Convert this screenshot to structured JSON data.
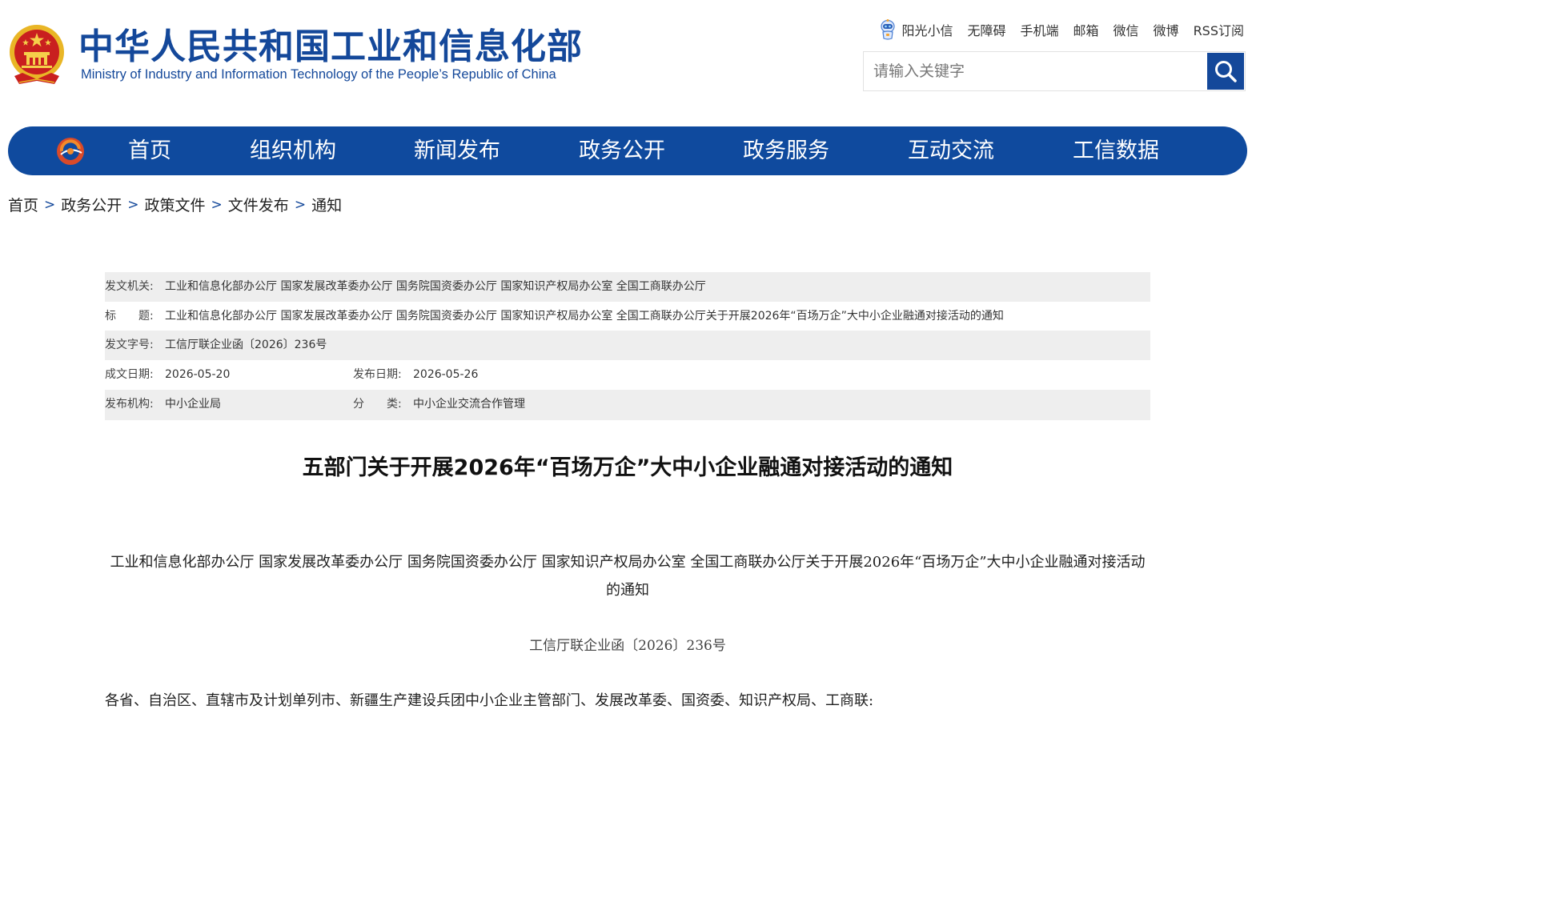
{
  "header": {
    "title_cn": "中华人民共和国工业和信息化部",
    "title_en": "Ministry of Industry and Information Technology of the People’s Republic of China",
    "emblem_icon": "national-emblem-icon",
    "brand_color": "#14489a"
  },
  "toplinks": {
    "sunshine_label": "阳光小信",
    "sunshine_icon": "robot-mascot-icon",
    "accessibility": "无障碍",
    "mobile": "手机端",
    "mailbox": "邮箱",
    "wechat": "微信",
    "weibo": "微博",
    "rss": "RSS订阅"
  },
  "search": {
    "placeholder": "请输入关键字",
    "button_icon": "search-icon"
  },
  "nav": {
    "logo_icon": "ministry-logo-icon",
    "background": "#0f4a9e",
    "items": [
      "首页",
      "组织机构",
      "新闻发布",
      "政务公开",
      "政务服务",
      "互动交流",
      "工信数据"
    ]
  },
  "breadcrumb": [
    "首页",
    "政务公开",
    "政策文件",
    "文件发布",
    "通知"
  ],
  "meta": {
    "issuer_label": "发文机关:",
    "issuer_value": "工业和信息化部办公厅 国家发展改革委办公厅 国务院国资委办公厅 国家知识产权局办公室 全国工商联办公厅",
    "title_label": "标　　题:",
    "title_value": "工业和信息化部办公厅 国家发展改革委办公厅 国务院国资委办公厅 国家知识产权局办公室 全国工商联办公厅关于开展2026年“百场万企”大中小企业融通对接活动的通知",
    "docno_label": "发文字号:",
    "docno_value": "工信厅联企业函〔2026〕236号",
    "written_label": "成文日期:",
    "written_value": "2026-05-20",
    "published_label": "发布日期:",
    "published_value": "2026-05-26",
    "org_label": "发布机构:",
    "org_value": "中小企业局",
    "category_label": "分　　类:",
    "category_value": "中小企业交流合作管理"
  },
  "article": {
    "title": "五部门关于开展2026年“百场万企”大中小企业融通对接活动的通知",
    "subtitle": "工业和信息化部办公厅 国家发展改革委办公厅 国务院国资委办公厅 国家知识产权局办公室 全国工商联办公厅关于开展2026年“百场万企”大中小企业融通对接活动的通知",
    "doc_number": "工信厅联企业函〔2026〕236号",
    "addressee": "各省、自治区、直辖市及计划单列市、新疆生产建设兵团中小企业主管部门、发展改革委、国资委、知识产权局、工商联:"
  }
}
